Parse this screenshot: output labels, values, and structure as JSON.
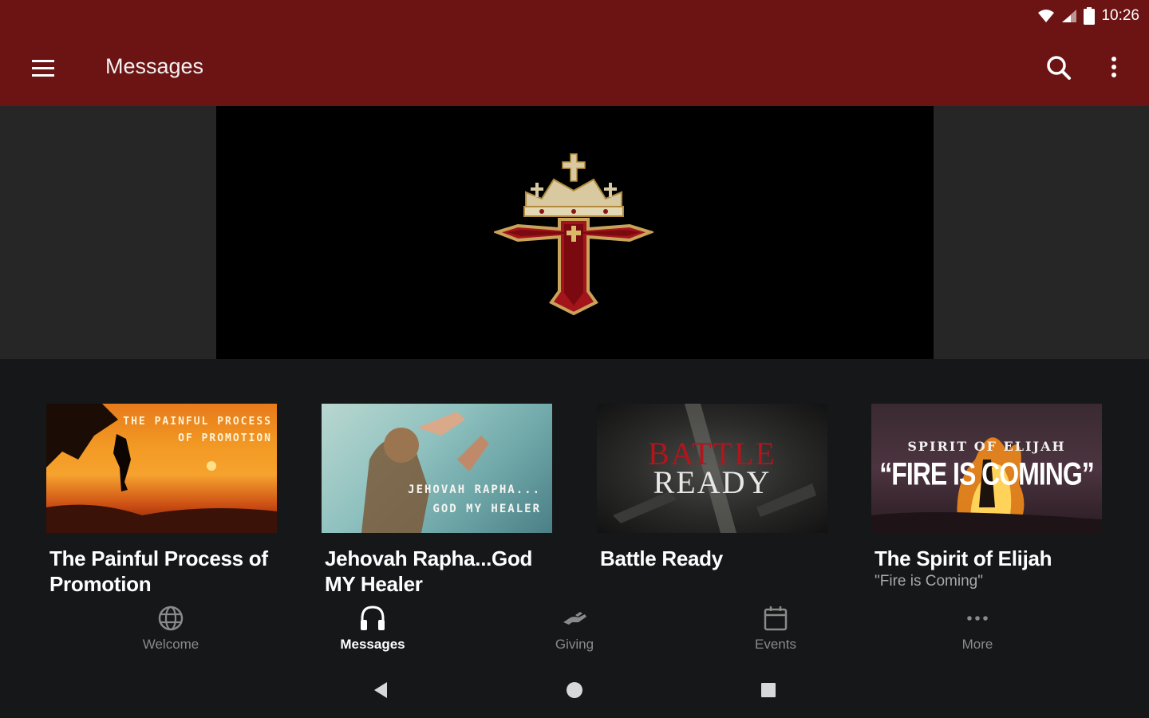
{
  "status_bar": {
    "time": "10:26",
    "icons": [
      "wifi-icon",
      "signal-icon",
      "battery-icon"
    ]
  },
  "app_bar": {
    "title": "Messages",
    "menu_icon": "hamburger-menu-icon",
    "search_icon": "search-icon",
    "overflow_icon": "more-vert-icon",
    "color": "#6c1414"
  },
  "hero": {
    "image": "crowned-cross-logo"
  },
  "cards": [
    {
      "title": "The Painful Process of Promotion",
      "subtitle": "",
      "thumb_text": "THE PAINFUL PROCESS\nOF PROMOTION"
    },
    {
      "title": "Jehovah Rapha...God MY Healer",
      "subtitle": "",
      "thumb_text": "JEHOVAH RAPHA...\nGOD MY HEALER"
    },
    {
      "title": "Battle Ready",
      "subtitle": "",
      "thumb_text_1": "BATTLE",
      "thumb_text_2": "READY"
    },
    {
      "title": "The Spirit of Elijah",
      "subtitle": "\"Fire is Coming\"",
      "thumb_text_1": "SPIRIT OF ELIJAH",
      "thumb_text_2": "“FIRE IS COMING”"
    }
  ],
  "bottom_nav": {
    "items": [
      {
        "label": "Welcome",
        "icon": "globe-icon",
        "active": false
      },
      {
        "label": "Messages",
        "icon": "headphones-icon",
        "active": true
      },
      {
        "label": "Giving",
        "icon": "giving-hand-icon",
        "active": false
      },
      {
        "label": "Events",
        "icon": "calendar-icon",
        "active": false
      },
      {
        "label": "More",
        "icon": "more-horiz-icon",
        "active": false
      }
    ]
  },
  "system_nav": {
    "buttons": [
      "back-icon",
      "home-icon",
      "recents-icon"
    ]
  }
}
